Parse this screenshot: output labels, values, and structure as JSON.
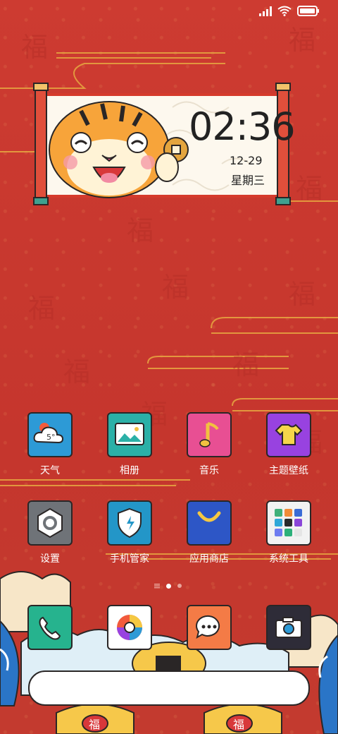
{
  "clock": {
    "time": "02:36",
    "date": "12-29",
    "weekday": "星期三"
  },
  "weather": {
    "temp": "5°"
  },
  "apps_row1": [
    {
      "name": "weather",
      "label": "天气",
      "color": "#2d9ad6"
    },
    {
      "name": "gallery",
      "label": "相册",
      "color": "#2bb0a7"
    },
    {
      "name": "music",
      "label": "音乐",
      "color": "#e84f93"
    },
    {
      "name": "themes",
      "label": "主题壁纸",
      "color": "#9842e0"
    }
  ],
  "apps_row2": [
    {
      "name": "settings",
      "label": "设置",
      "color": "#6f7378"
    },
    {
      "name": "security",
      "label": "手机管家",
      "color": "#2396c8"
    },
    {
      "name": "app-store",
      "label": "应用商店",
      "color": "#2d56c6"
    },
    {
      "name": "tools",
      "label": "系统工具",
      "color": "#f2f2f2"
    }
  ],
  "dock": [
    {
      "name": "phone",
      "color": "#26b38e"
    },
    {
      "name": "browser",
      "color": "#ffffff"
    },
    {
      "name": "messages",
      "color": "#f47b46"
    },
    {
      "name": "camera",
      "color": "#2e2c38"
    }
  ],
  "decor_text": "福"
}
